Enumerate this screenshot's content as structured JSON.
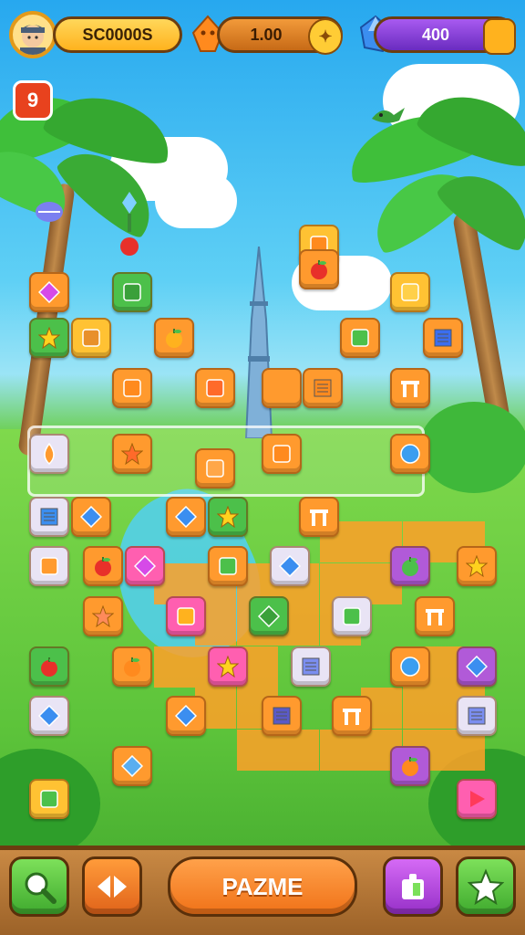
{
  "hud": {
    "score_value": "SC0000S",
    "coin_value": "1.00",
    "gem_value": "400",
    "level_badge": "9"
  },
  "bottom": {
    "center_button_label": "PAZME"
  },
  "colors": {
    "score_bar": "#ffc22b",
    "coin_bar": "#e98a2a",
    "gem_bar": "#8a3ad6",
    "tile_orange": "#ff9a2e",
    "tile_pink": "#ff5fb0",
    "tile_green": "#4cc04a",
    "tile_purple": "#b15ad8"
  },
  "icons": {
    "avatar": "player-avatar-icon",
    "coin": "bell-coin-icon",
    "gem": "blue-gem-icon",
    "hint": "magnifier-icon",
    "shuffle": "arrows-icon",
    "puzzle": "puzzle-piece-icon",
    "star": "star-icon",
    "play": "play-triangle-icon"
  }
}
